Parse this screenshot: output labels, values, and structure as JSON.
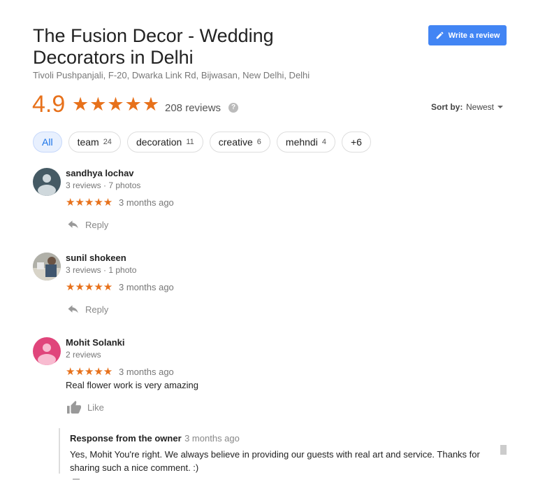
{
  "business": {
    "title": "The Fusion Decor - Wedding Decorators in Delhi",
    "address": "Tivoli Pushpanjali, F-20, Dwarka Link Rd, Bijwasan, New Delhi, Delhi",
    "write_review_label": "Write a review"
  },
  "rating": {
    "value": "4.9",
    "stars": "★★★★★",
    "count_label": "208 reviews",
    "help": "?"
  },
  "sort": {
    "label": "Sort by:",
    "value": "Newest"
  },
  "chips": [
    {
      "label": "All",
      "count": ""
    },
    {
      "label": "team",
      "count": "24"
    },
    {
      "label": "decoration",
      "count": "11"
    },
    {
      "label": "creative",
      "count": "6"
    },
    {
      "label": "mehndi",
      "count": "4"
    },
    {
      "label": "+6",
      "count": ""
    }
  ],
  "reviews": [
    {
      "name": "sandhya lochav",
      "meta": "3 reviews · 7 photos",
      "stars": "★★★★★",
      "time": "3 months ago",
      "action": "Reply",
      "avatar_color": "#455a64"
    },
    {
      "name": "sunil shokeen",
      "meta": "3 reviews · 1 photo",
      "stars": "★★★★★",
      "time": "3 months ago",
      "action": "Reply",
      "avatar_color": "#8d8d8d"
    },
    {
      "name": "Mohit Solanki",
      "meta": "2 reviews",
      "stars": "★★★★★",
      "time": "3 months ago",
      "text": "Real flower work is very amazing",
      "action": "Like",
      "avatar_color": "#e0457b"
    }
  ],
  "owner_response": {
    "title": "Response from the owner",
    "time": "3 months ago",
    "text": "Yes, Mohit You're right. We always believe in providing our guests with real art and service. Thanks for sharing such a nice comment. :)"
  },
  "colors": {
    "accent": "#e7711b",
    "button": "#4285f4",
    "active_chip": "#e8f0fe"
  }
}
